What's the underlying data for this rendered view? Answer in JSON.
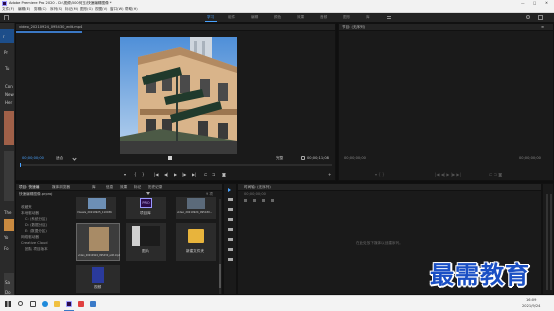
{
  "app": {
    "title": "Adobe Premiere Pro 2020 - D:\\视频\\500何玉\\快速编辑图像 *",
    "window_controls": [
      "—",
      "□",
      "✕"
    ]
  },
  "menu": [
    "文件(F)",
    "编辑(E)",
    "剪辑(C)",
    "序列(S)",
    "标记(M)",
    "图形(G)",
    "视图(V)",
    "窗口(W)",
    "帮助(H)"
  ],
  "workspaces": [
    "学习",
    "组件",
    "编辑",
    "颜色",
    "效果",
    "音频",
    "图形",
    "库"
  ],
  "workspace_active": 0,
  "left_strip": [
    "r",
    "Pr",
    "Tu",
    "Con",
    "New",
    "Her"
  ],
  "left_strip_lower": [
    "The",
    "Yo",
    "Fo",
    "Sa",
    "Do",
    "Co"
  ],
  "source_monitor": {
    "tab": "video_20210924_095430_edit.mp4",
    "timecode_left": "00;00;00;00",
    "fit": "适合",
    "quality": "完整",
    "timecode_right": "00;00;11;08"
  },
  "program_monitor": {
    "tab": "节目: (无序列)",
    "timecode_left": "00;00;00;00",
    "timecode_right": "00;00;00;00"
  },
  "project": {
    "tabs": [
      "项目: 快速编",
      "媒体浏览器",
      "库",
      "信息",
      "效果",
      "标记",
      "历史记录"
    ],
    "path": "快速编辑图像.prproj",
    "count": "9 项",
    "tree_items": [
      "收藏夹",
      "本地驱动器",
      "C: (系统分区)",
      "D: (数据分区)",
      "E: (数据分区)",
      "网络驱动器",
      "Creative Cloud",
      "团队 项目版本"
    ],
    "thumbs": [
      {
        "label": "Visuals_20210925_110036",
        "kind": "video"
      },
      {
        "label": "项目库",
        "kind": "pr"
      },
      {
        "label": "video_20210924_095430...",
        "kind": "video"
      },
      {
        "label": "video_20210924_095430_edit.mp4",
        "kind": "video",
        "selected": true
      },
      {
        "label": "图片",
        "kind": "image"
      },
      {
        "label": "新建文件夹",
        "kind": "folder"
      },
      {
        "label": "视频",
        "kind": "video2"
      }
    ]
  },
  "timeline": {
    "tab": "时间轴: (无序列)",
    "timecode": "00;00;00;00",
    "empty_message": "在此处放下媒体以创建序列。"
  },
  "taskbar": {
    "time": "16:09",
    "date": "2021/9/24"
  },
  "watermark": "最需教育"
}
